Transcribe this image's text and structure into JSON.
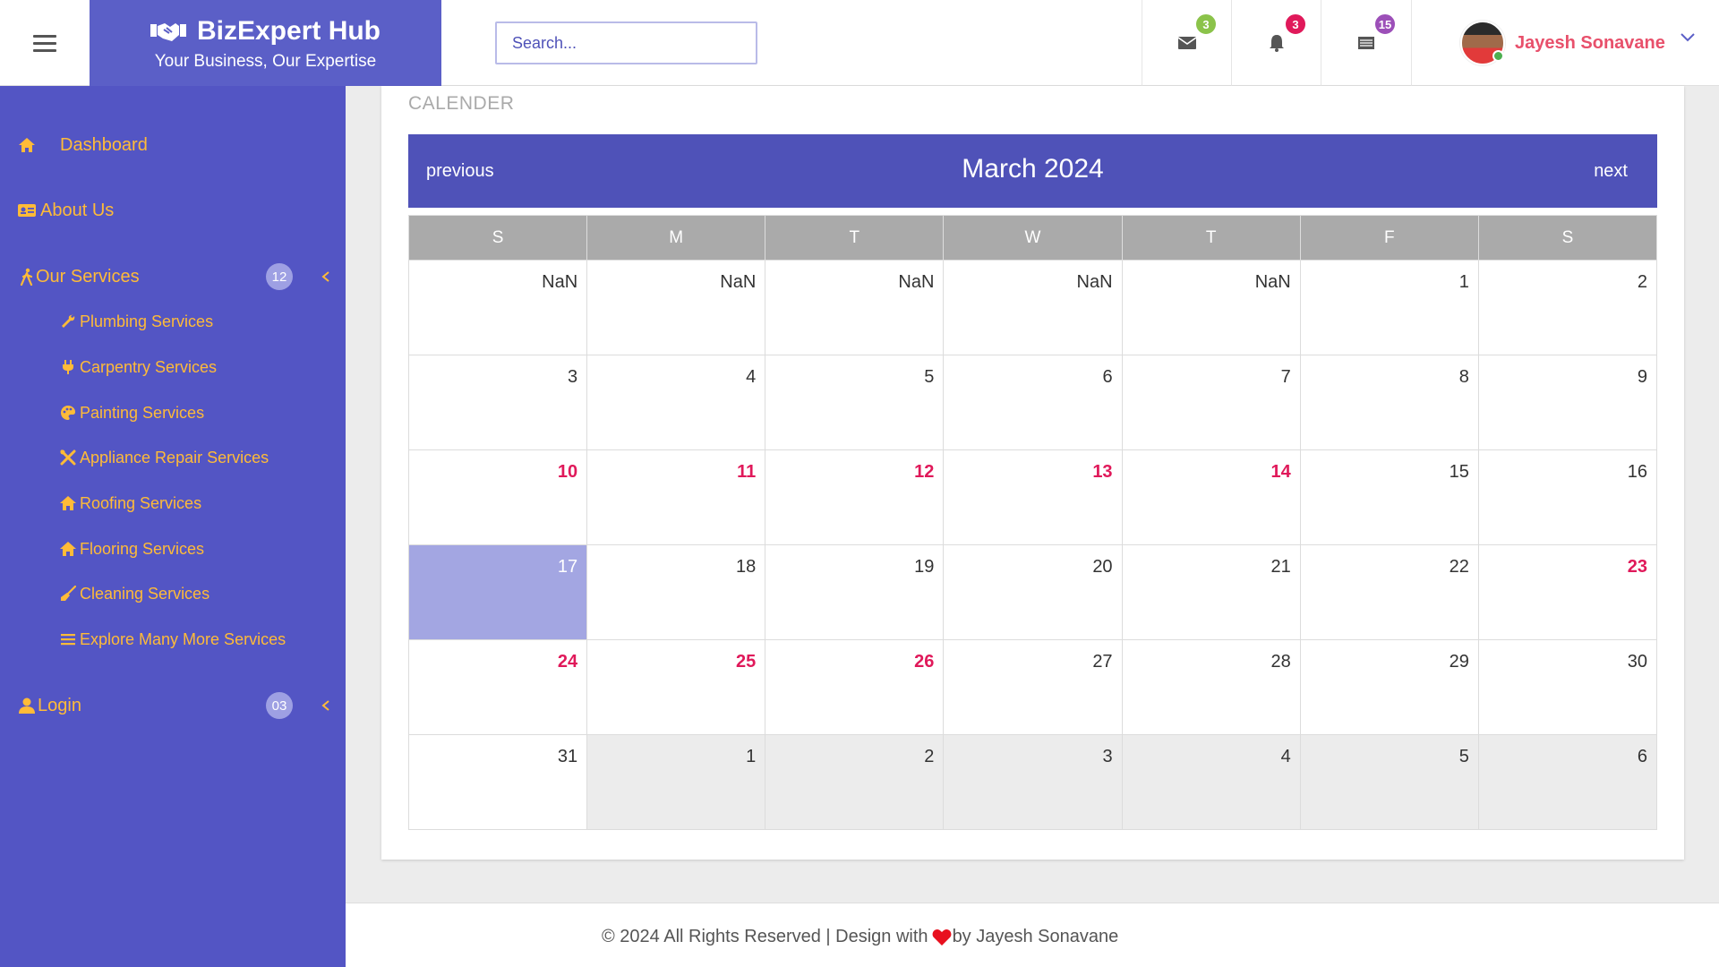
{
  "header": {
    "brand_title": "BizExpert Hub",
    "brand_tagline": "Your Business, Our Expertise",
    "search_placeholder": "Search...",
    "icons": [
      {
        "name": "envelope-icon",
        "badge": "3",
        "badge_color": "#8bc34a"
      },
      {
        "name": "bell-icon",
        "badge": "3",
        "badge_color": "#e0195a"
      },
      {
        "name": "list-icon",
        "badge": "15",
        "badge_color": "#9c4fb8"
      }
    ],
    "user_name": "Jayesh Sonavane"
  },
  "sidebar": {
    "items": [
      {
        "label": "Dashboard",
        "icon": "home-icon"
      },
      {
        "label": "About Us",
        "icon": "id-card-icon"
      },
      {
        "label": "Our Services",
        "icon": "person-walking-icon",
        "badge": "12"
      },
      {
        "label": "Login",
        "icon": "user-icon",
        "badge": "03"
      }
    ],
    "services": [
      {
        "label": "Plumbing Services",
        "icon": "wrench-icon"
      },
      {
        "label": "Carpentry Services",
        "icon": "plug-icon"
      },
      {
        "label": "Painting Services",
        "icon": "palette-icon"
      },
      {
        "label": "Appliance Repair Services",
        "icon": "tools-icon"
      },
      {
        "label": "Roofing Services",
        "icon": "home-icon"
      },
      {
        "label": "Flooring Services",
        "icon": "home-icon"
      },
      {
        "label": "Cleaning Services",
        "icon": "broom-icon"
      },
      {
        "label": "Explore Many More Services",
        "icon": "bars-icon"
      }
    ]
  },
  "calendar": {
    "section_title": "CALENDER",
    "prev_label": "previous",
    "next_label": "next",
    "month_label": "March 2024",
    "weekdays": [
      "S",
      "M",
      "T",
      "W",
      "T",
      "F",
      "S"
    ],
    "weeks": [
      [
        {
          "t": "NaN"
        },
        {
          "t": "NaN"
        },
        {
          "t": "NaN"
        },
        {
          "t": "NaN"
        },
        {
          "t": "NaN"
        },
        {
          "t": "1"
        },
        {
          "t": "2"
        }
      ],
      [
        {
          "t": "3"
        },
        {
          "t": "4"
        },
        {
          "t": "5"
        },
        {
          "t": "6"
        },
        {
          "t": "7"
        },
        {
          "t": "8"
        },
        {
          "t": "9"
        }
      ],
      [
        {
          "t": "10",
          "h": true
        },
        {
          "t": "11",
          "h": true
        },
        {
          "t": "12",
          "h": true
        },
        {
          "t": "13",
          "h": true
        },
        {
          "t": "14",
          "h": true
        },
        {
          "t": "15"
        },
        {
          "t": "16"
        }
      ],
      [
        {
          "t": "17",
          "today": true
        },
        {
          "t": "18"
        },
        {
          "t": "19"
        },
        {
          "t": "20"
        },
        {
          "t": "21"
        },
        {
          "t": "22"
        },
        {
          "t": "23",
          "h": true
        }
      ],
      [
        {
          "t": "24",
          "h": true
        },
        {
          "t": "25",
          "h": true
        },
        {
          "t": "26",
          "h": true
        },
        {
          "t": "27"
        },
        {
          "t": "28"
        },
        {
          "t": "29"
        },
        {
          "t": "30"
        }
      ],
      [
        {
          "t": "31"
        },
        {
          "t": "1",
          "o": true
        },
        {
          "t": "2",
          "o": true
        },
        {
          "t": "3",
          "o": true
        },
        {
          "t": "4",
          "o": true
        },
        {
          "t": "5",
          "o": true
        },
        {
          "t": "6",
          "o": true
        }
      ]
    ]
  },
  "footer": {
    "text_before": "© 2024 All Rights Reserved | Design with ",
    "text_after": "by Jayesh Sonavane"
  },
  "colors": {
    "brand": "#5b5fc7",
    "sidebar": "#5355c4",
    "accent_orange": "#ffbb38",
    "holiday": "#e0195a",
    "today": "#a3a6e2",
    "user_name": "#e8506b"
  }
}
